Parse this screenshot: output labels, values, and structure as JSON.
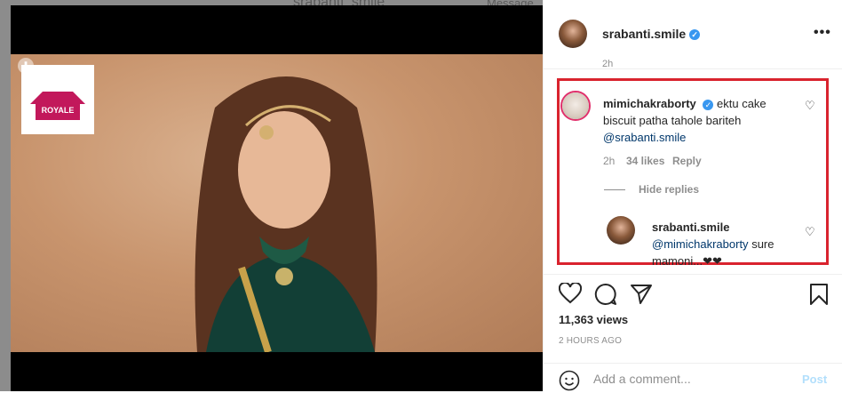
{
  "backdrop": {
    "title_fragment": "srabanti_smile",
    "message_btn": "Message"
  },
  "media": {
    "brand_logo_text": "ROYALE",
    "download_icon": "download-icon",
    "sound_icon": "speaker-icon"
  },
  "header": {
    "username": "srabanti.smile",
    "verified_icon": "verified-badge-icon",
    "more_icon": "more-horizontal-icon"
  },
  "comments": {
    "cut_time": "2h",
    "main": {
      "username": "mimichakraborty",
      "text": "ektu cake biscuit patha tahole bariteh",
      "mention": "@srabanti.smile",
      "time": "2h",
      "likes": "34 likes",
      "reply_label": "Reply"
    },
    "hide_replies": "Hide replies",
    "reply": {
      "username": "srabanti.smile",
      "mention": "@mimichakraborty",
      "text": "sure mamoni...❤❤"
    }
  },
  "actions": {
    "like_icon": "heart-icon",
    "comment_icon": "comment-icon",
    "share_icon": "share-icon",
    "save_icon": "bookmark-icon",
    "views": "11,363 views",
    "time": "2 HOURS AGO"
  },
  "add_comment": {
    "placeholder": "Add a comment...",
    "post_label": "Post",
    "emoji_icon": "emoji-icon"
  }
}
